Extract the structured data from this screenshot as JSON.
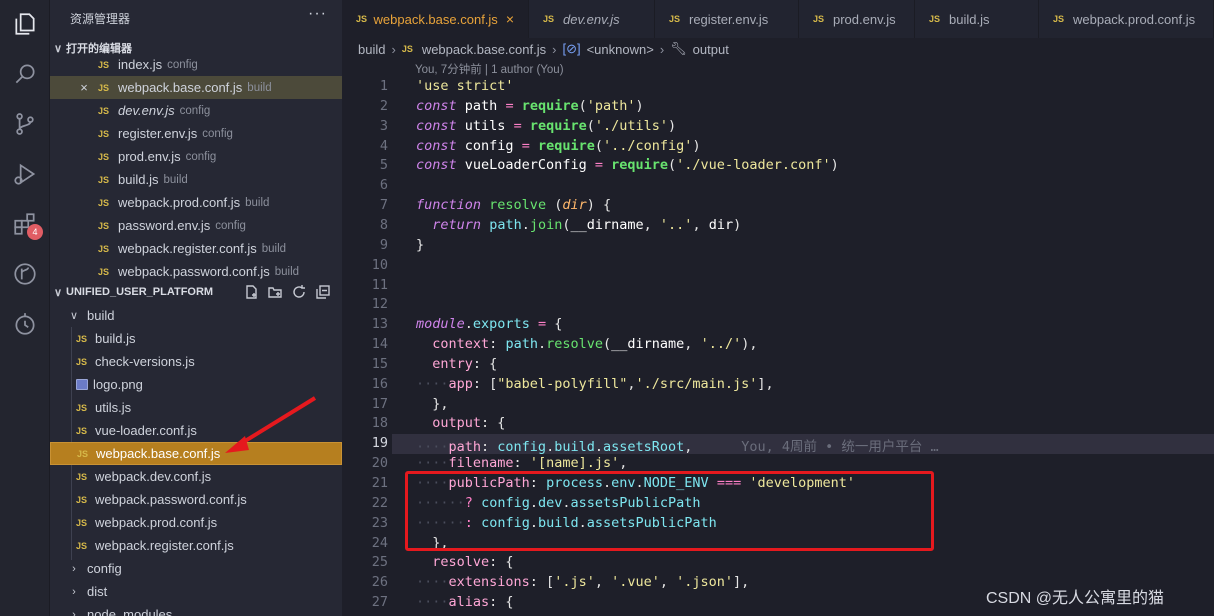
{
  "activity_bar": {
    "extensions_badge": "4"
  },
  "sidebar": {
    "title": "资源管理器",
    "more": "···",
    "open_editors_header": "打开的编辑器",
    "open_editors": [
      {
        "name": "index.js",
        "dir": "config",
        "italic": false,
        "close": false
      },
      {
        "name": "webpack.base.conf.js",
        "dir": "build",
        "italic": false,
        "close": true,
        "selected": true
      },
      {
        "name": "dev.env.js",
        "dir": "config",
        "italic": true,
        "close": false
      },
      {
        "name": "register.env.js",
        "dir": "config",
        "italic": false,
        "close": false
      },
      {
        "name": "prod.env.js",
        "dir": "config",
        "italic": false,
        "close": false
      },
      {
        "name": "build.js",
        "dir": "build",
        "italic": false,
        "close": false
      },
      {
        "name": "webpack.prod.conf.js",
        "dir": "build",
        "italic": false,
        "close": false
      },
      {
        "name": "password.env.js",
        "dir": "config",
        "italic": false,
        "close": false
      },
      {
        "name": "webpack.register.conf.js",
        "dir": "build",
        "italic": false,
        "close": false
      },
      {
        "name": "webpack.password.conf.js",
        "dir": "build",
        "italic": false,
        "close": false
      }
    ],
    "workspace_header": "UNIFIED_USER_PLATFORM",
    "tree": {
      "build_folder": "build",
      "build_files": [
        {
          "name": "build.js",
          "icon": "js-icon"
        },
        {
          "name": "check-versions.js",
          "icon": "js-icon"
        },
        {
          "name": "logo.png",
          "icon": "image-icon"
        },
        {
          "name": "utils.js",
          "icon": "js-icon"
        },
        {
          "name": "vue-loader.conf.js",
          "icon": "js-icon"
        },
        {
          "name": "webpack.base.conf.js",
          "icon": "js-icon",
          "highlighted": true
        },
        {
          "name": "webpack.dev.conf.js",
          "icon": "js-icon"
        },
        {
          "name": "webpack.password.conf.js",
          "icon": "js-icon"
        },
        {
          "name": "webpack.prod.conf.js",
          "icon": "js-icon"
        },
        {
          "name": "webpack.register.conf.js",
          "icon": "js-icon"
        }
      ],
      "folders": [
        "config",
        "dist",
        "node_modules"
      ]
    }
  },
  "tabs": [
    {
      "label": "webpack.base.conf.js",
      "active": true,
      "italic": false
    },
    {
      "label": "dev.env.js",
      "active": false,
      "italic": true
    },
    {
      "label": "register.env.js",
      "active": false,
      "italic": false
    },
    {
      "label": "prod.env.js",
      "active": false,
      "italic": false
    },
    {
      "label": "build.js",
      "active": false,
      "italic": false
    },
    {
      "label": "webpack.prod.conf.js",
      "active": false,
      "italic": false
    }
  ],
  "breadcrumb": {
    "folder": "build",
    "file": "webpack.base.conf.js",
    "symbol1": "<unknown>",
    "symbol2": "output"
  },
  "blame_header": "You, 7分钟前 | 1 author (You)",
  "editor": {
    "current_line": 19,
    "line_numbers": [
      "1",
      "2",
      "3",
      "4",
      "5",
      "6",
      "7",
      "8",
      "9",
      "10",
      "11",
      "12",
      "13",
      "14",
      "15",
      "16",
      "17",
      "18",
      "19",
      "20",
      "21",
      "22",
      "23",
      "24",
      "25",
      "26",
      "27"
    ],
    "lines": [
      [
        [
          "s",
          "'use strict'"
        ]
      ],
      [
        [
          "k",
          "const"
        ],
        [
          "tx",
          " "
        ],
        [
          "v",
          "path"
        ],
        [
          "tx",
          " "
        ],
        [
          "op",
          "="
        ],
        [
          "tx",
          " "
        ],
        [
          "fnb",
          "require"
        ],
        [
          "tx",
          "("
        ],
        [
          "s",
          "'path'"
        ],
        [
          "tx",
          ")"
        ]
      ],
      [
        [
          "k",
          "const"
        ],
        [
          "tx",
          " "
        ],
        [
          "v",
          "utils"
        ],
        [
          "tx",
          " "
        ],
        [
          "op",
          "="
        ],
        [
          "tx",
          " "
        ],
        [
          "fnb",
          "require"
        ],
        [
          "tx",
          "("
        ],
        [
          "s",
          "'./utils'"
        ],
        [
          "tx",
          ")"
        ]
      ],
      [
        [
          "k",
          "const"
        ],
        [
          "tx",
          " "
        ],
        [
          "v",
          "config"
        ],
        [
          "tx",
          " "
        ],
        [
          "op",
          "="
        ],
        [
          "tx",
          " "
        ],
        [
          "fnb",
          "require"
        ],
        [
          "tx",
          "("
        ],
        [
          "s",
          "'../config'"
        ],
        [
          "tx",
          ")"
        ]
      ],
      [
        [
          "k",
          "const"
        ],
        [
          "tx",
          " "
        ],
        [
          "v",
          "vueLoaderConfig"
        ],
        [
          "tx",
          " "
        ],
        [
          "op",
          "="
        ],
        [
          "tx",
          " "
        ],
        [
          "fnb",
          "require"
        ],
        [
          "tx",
          "("
        ],
        [
          "s",
          "'./vue-loader.conf'"
        ],
        [
          "tx",
          ")"
        ]
      ],
      [],
      [
        [
          "k",
          "function"
        ],
        [
          "tx",
          " "
        ],
        [
          "fn",
          "resolve"
        ],
        [
          "tx",
          " ("
        ],
        [
          "par",
          "dir"
        ],
        [
          "tx",
          ") {"
        ]
      ],
      [
        [
          "dot",
          "  "
        ],
        [
          "k",
          "return"
        ],
        [
          "tx",
          " "
        ],
        [
          "pr",
          "path"
        ],
        [
          "tx",
          "."
        ],
        [
          "fn",
          "join"
        ],
        [
          "tx",
          "("
        ],
        [
          "v",
          "__dirname"
        ],
        [
          "tx",
          ", "
        ],
        [
          "s",
          "'..'"
        ],
        [
          "tx",
          ", "
        ],
        [
          "v",
          "dir"
        ],
        [
          "tx",
          ")"
        ]
      ],
      [
        [
          "tx",
          "}"
        ]
      ],
      [],
      [],
      [],
      [
        [
          "k",
          "module"
        ],
        [
          "tx",
          "."
        ],
        [
          "pr",
          "exports"
        ],
        [
          "tx",
          " "
        ],
        [
          "op",
          "="
        ],
        [
          "tx",
          " {"
        ]
      ],
      [
        [
          "dot",
          "  "
        ],
        [
          "p",
          "context"
        ],
        [
          "tx",
          ": "
        ],
        [
          "pr",
          "path"
        ],
        [
          "tx",
          "."
        ],
        [
          "fn",
          "resolve"
        ],
        [
          "tx",
          "("
        ],
        [
          "v",
          "__dirname"
        ],
        [
          "tx",
          ", "
        ],
        [
          "s",
          "'../'"
        ],
        [
          "tx",
          "),"
        ]
      ],
      [
        [
          "dot",
          "  "
        ],
        [
          "p",
          "entry"
        ],
        [
          "tx",
          ": {"
        ]
      ],
      [
        [
          "dot",
          "····"
        ],
        [
          "p",
          "app"
        ],
        [
          "tx",
          ": ["
        ],
        [
          "s",
          "\"babel-polyfill\""
        ],
        [
          "tx",
          ","
        ],
        [
          "s",
          "'./src/main.js'"
        ],
        [
          "tx",
          "],"
        ]
      ],
      [
        [
          "dot",
          "  "
        ],
        [
          "tx",
          "},"
        ]
      ],
      [
        [
          "dot",
          "  "
        ],
        [
          "p",
          "output"
        ],
        [
          "tx",
          ": {"
        ]
      ],
      [
        [
          "dot",
          "····"
        ],
        [
          "p",
          "path"
        ],
        [
          "tx",
          ": "
        ],
        [
          "pr",
          "config"
        ],
        [
          "tx",
          "."
        ],
        [
          "pr",
          "build"
        ],
        [
          "tx",
          "."
        ],
        [
          "pr",
          "assetsRoot"
        ],
        [
          "tx",
          ","
        ],
        [
          "ghost",
          "      You, 4周前 • 统一用户平台 …"
        ]
      ],
      [
        [
          "dot",
          "····"
        ],
        [
          "p",
          "filename"
        ],
        [
          "tx",
          ": "
        ],
        [
          "s",
          "'[name].js'"
        ],
        [
          "tx",
          ","
        ]
      ],
      [
        [
          "dot",
          "····"
        ],
        [
          "p",
          "publicPath"
        ],
        [
          "tx",
          ": "
        ],
        [
          "pr",
          "process"
        ],
        [
          "tx",
          "."
        ],
        [
          "pr",
          "env"
        ],
        [
          "tx",
          "."
        ],
        [
          "pr",
          "NODE_ENV"
        ],
        [
          "tx",
          " "
        ],
        [
          "op",
          "==="
        ],
        [
          "tx",
          " "
        ],
        [
          "s",
          "'development'"
        ]
      ],
      [
        [
          "dot",
          "······"
        ],
        [
          "op",
          "?"
        ],
        [
          "tx",
          " "
        ],
        [
          "pr",
          "config"
        ],
        [
          "tx",
          "."
        ],
        [
          "pr",
          "dev"
        ],
        [
          "tx",
          "."
        ],
        [
          "pr",
          "assetsPublicPath"
        ]
      ],
      [
        [
          "dot",
          "······"
        ],
        [
          "op",
          ":"
        ],
        [
          "tx",
          " "
        ],
        [
          "pr",
          "config"
        ],
        [
          "tx",
          "."
        ],
        [
          "pr",
          "build"
        ],
        [
          "tx",
          "."
        ],
        [
          "pr",
          "assetsPublicPath"
        ]
      ],
      [
        [
          "dot",
          "  "
        ],
        [
          "tx",
          "},"
        ]
      ],
      [
        [
          "dot",
          "  "
        ],
        [
          "p",
          "resolve"
        ],
        [
          "tx",
          ": {"
        ]
      ],
      [
        [
          "dot",
          "····"
        ],
        [
          "p",
          "extensions"
        ],
        [
          "tx",
          ": ["
        ],
        [
          "s",
          "'.js'"
        ],
        [
          "tx",
          ", "
        ],
        [
          "s",
          "'.vue'"
        ],
        [
          "tx",
          ", "
        ],
        [
          "s",
          "'.json'"
        ],
        [
          "tx",
          "],"
        ]
      ],
      [
        [
          "dot",
          "····"
        ],
        [
          "p",
          "alias"
        ],
        [
          "tx",
          ": {"
        ]
      ]
    ]
  },
  "watermark": "CSDN @无人公寓里的猫",
  "colors": {
    "accent": "#e8a33a",
    "highlight": "#b67f1f",
    "annotation_red": "#e5191e"
  }
}
